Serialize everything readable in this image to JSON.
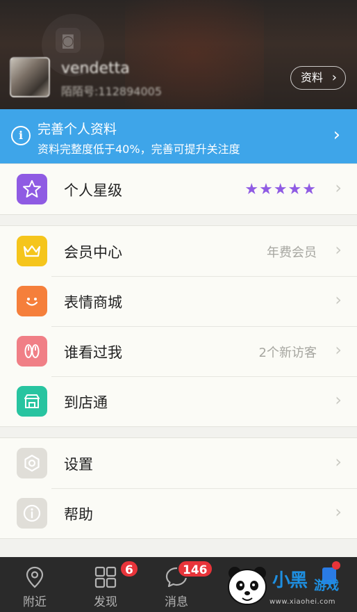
{
  "header": {
    "username": "vendetta",
    "user_id": "陌陌号:112894005",
    "profile_button_label": "资料",
    "profile_button_chevron": "›"
  },
  "banner": {
    "title": "完善个人资料",
    "subtitle": "资料完整度低于40%，完善可提升关注度",
    "info_icon": "i",
    "chevron": "›",
    "color": "#3ea5e9"
  },
  "rating": {
    "label": "个人星级",
    "stars_glyph": "★★★★★",
    "stars": 5,
    "star_color": "#8f5be3"
  },
  "services": [
    {
      "label": "会员中心",
      "value": "年费会员",
      "icon": "crown-icon",
      "color": "#f5c51c"
    },
    {
      "label": "表情商城",
      "value": "",
      "icon": "smiley-icon",
      "color": "#f57f3b"
    },
    {
      "label": "谁看过我",
      "value": "2个新访客",
      "icon": "footprints-icon",
      "color": "#f07f86"
    },
    {
      "label": "到店通",
      "value": "",
      "icon": "store-icon",
      "color": "#28c4a0"
    }
  ],
  "system": [
    {
      "label": "设置",
      "icon": "settings-icon",
      "color": "#e0ded8"
    },
    {
      "label": "帮助",
      "icon": "help-icon",
      "color": "#e0ded8"
    }
  ],
  "chevron": "›",
  "tabbar": {
    "tabs": [
      {
        "label": "附近",
        "icon": "location-pin-icon",
        "badge": ""
      },
      {
        "label": "发现",
        "icon": "grid-icon",
        "badge": "6"
      },
      {
        "label": "消息",
        "icon": "chat-bubble-icon",
        "badge": "146"
      }
    ]
  },
  "watermark": {
    "logo_text": "小黑",
    "logo_text2": "游戏",
    "url": "www.xiaohei.com"
  }
}
